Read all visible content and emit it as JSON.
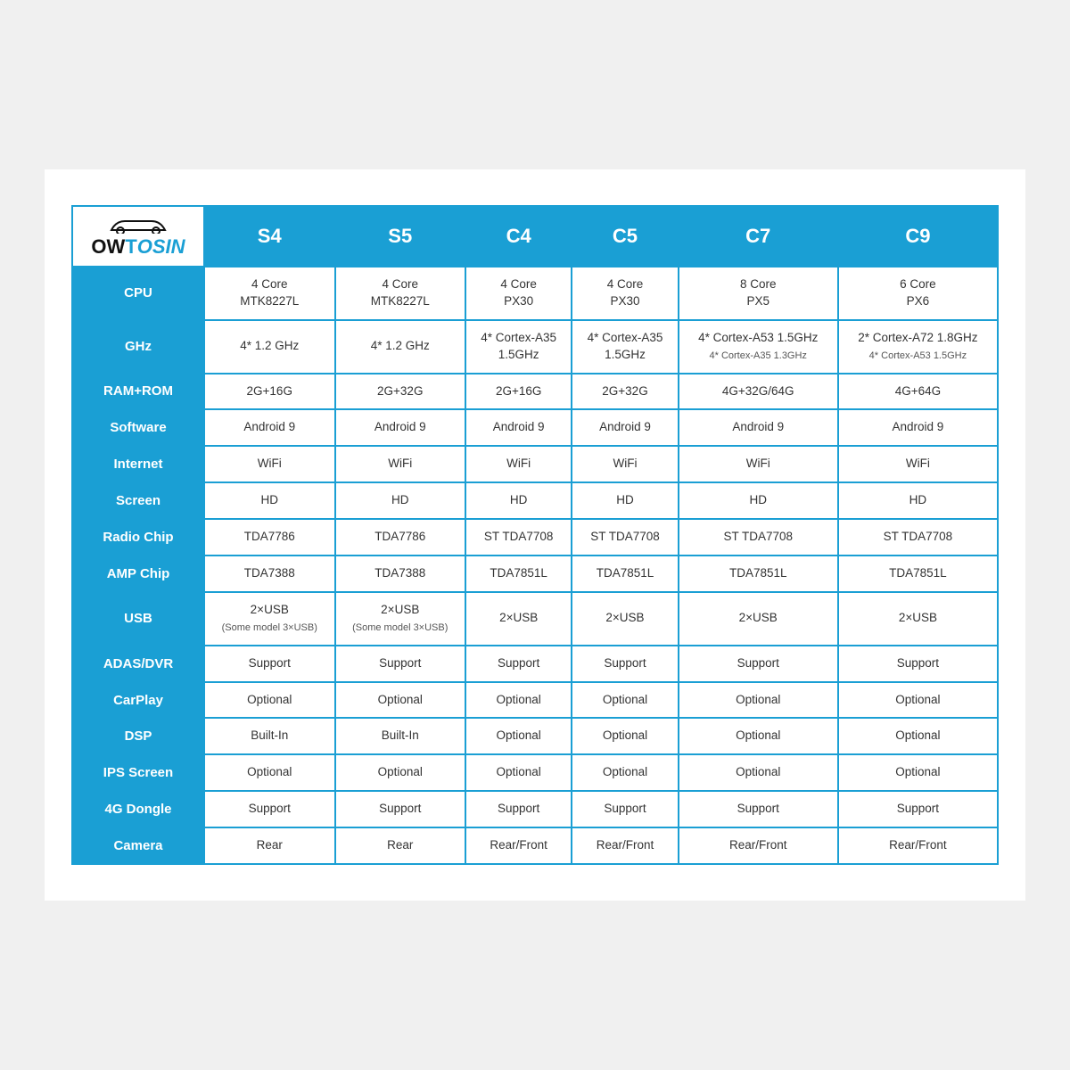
{
  "logo": {
    "brand1": "OW",
    "brand2": "T",
    "brand3": "OSIN"
  },
  "columns": [
    "S4",
    "S5",
    "C4",
    "C5",
    "C7",
    "C9"
  ],
  "rows": [
    {
      "label": "CPU",
      "cells": [
        "4 Core\nMTK8227L",
        "4 Core\nMTK8227L",
        "4 Core\nPX30",
        "4 Core\nPX30",
        "8 Core\nPX5",
        "6 Core\nPX6"
      ]
    },
    {
      "label": "GHz",
      "cells": [
        "4* 1.2 GHz",
        "4* 1.2 GHz",
        "4* Cortex-A35\n1.5GHz",
        "4* Cortex-A35\n1.5GHz",
        "4* Cortex-A53 1.5GHz\n4* Cortex-A35 1.3GHz",
        "2* Cortex-A72 1.8GHz\n4* Cortex-A53 1.5GHz"
      ]
    },
    {
      "label": "RAM+ROM",
      "cells": [
        "2G+16G",
        "2G+32G",
        "2G+16G",
        "2G+32G",
        "4G+32G/64G",
        "4G+64G"
      ]
    },
    {
      "label": "Software",
      "cells": [
        "Android 9",
        "Android 9",
        "Android 9",
        "Android 9",
        "Android 9",
        "Android 9"
      ]
    },
    {
      "label": "Internet",
      "cells": [
        "WiFi",
        "WiFi",
        "WiFi",
        "WiFi",
        "WiFi",
        "WiFi"
      ]
    },
    {
      "label": "Screen",
      "cells": [
        "HD",
        "HD",
        "HD",
        "HD",
        "HD",
        "HD"
      ]
    },
    {
      "label": "Radio Chip",
      "cells": [
        "TDA7786",
        "TDA7786",
        "ST TDA7708",
        "ST TDA7708",
        "ST TDA7708",
        "ST TDA7708"
      ]
    },
    {
      "label": "AMP Chip",
      "cells": [
        "TDA7388",
        "TDA7388",
        "TDA7851L",
        "TDA7851L",
        "TDA7851L",
        "TDA7851L"
      ]
    },
    {
      "label": "USB",
      "cells": [
        "2×USB\n(Some model 3×USB)",
        "2×USB\n(Some model 3×USB)",
        "2×USB",
        "2×USB",
        "2×USB",
        "2×USB"
      ]
    },
    {
      "label": "ADAS/DVR",
      "cells": [
        "Support",
        "Support",
        "Support",
        "Support",
        "Support",
        "Support"
      ]
    },
    {
      "label": "CarPlay",
      "cells": [
        "Optional",
        "Optional",
        "Optional",
        "Optional",
        "Optional",
        "Optional"
      ]
    },
    {
      "label": "DSP",
      "cells": [
        "Built-In",
        "Built-In",
        "Optional",
        "Optional",
        "Optional",
        "Optional"
      ]
    },
    {
      "label": "IPS Screen",
      "cells": [
        "Optional",
        "Optional",
        "Optional",
        "Optional",
        "Optional",
        "Optional"
      ]
    },
    {
      "label": "4G Dongle",
      "cells": [
        "Support",
        "Support",
        "Support",
        "Support",
        "Support",
        "Support"
      ]
    },
    {
      "label": "Camera",
      "cells": [
        "Rear",
        "Rear",
        "Rear/Front",
        "Rear/Front",
        "Rear/Front",
        "Rear/Front"
      ]
    }
  ]
}
